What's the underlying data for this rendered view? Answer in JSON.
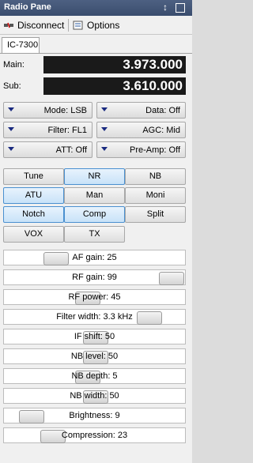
{
  "window": {
    "title": "Radio Pane",
    "pin_glyph": "↕"
  },
  "toolbar": {
    "disconnect": "Disconnect",
    "options": "Options"
  },
  "tabs": [
    {
      "label": "IC-7300"
    }
  ],
  "frequencies": {
    "main": {
      "label": "Main:",
      "value": "3.973.000"
    },
    "sub": {
      "label": "Sub:",
      "value": "3.610.000"
    }
  },
  "dropdowns": [
    {
      "label": "Mode: LSB"
    },
    {
      "label": "Data: Off"
    },
    {
      "label": "Filter: FL1"
    },
    {
      "label": "AGC: Mid"
    },
    {
      "label": "ATT: Off"
    },
    {
      "label": "Pre-Amp: Off"
    }
  ],
  "toggles": [
    {
      "label": "Tune",
      "active": false
    },
    {
      "label": "NR",
      "active": true
    },
    {
      "label": "NB",
      "active": false
    },
    {
      "label": "ATU",
      "active": true
    },
    {
      "label": "Man",
      "active": false
    },
    {
      "label": "Moni",
      "active": false
    },
    {
      "label": "Notch",
      "active": true
    },
    {
      "label": "Comp",
      "active": true
    },
    {
      "label": "Split",
      "active": false
    },
    {
      "label": "VOX",
      "active": false
    },
    {
      "label": "TX",
      "active": false
    }
  ],
  "sliders": [
    {
      "label": "AF gain: 25",
      "level": 0.25
    },
    {
      "label": "RF gain: 99",
      "level": 0.99
    },
    {
      "label": "RF power: 45",
      "level": 0.45
    },
    {
      "label": "Filter width: 3.3 kHz",
      "level": 0.85
    },
    {
      "label": "IF shift: 50",
      "level": 0.5
    },
    {
      "label": "NB level: 50",
      "level": 0.5
    },
    {
      "label": "NB depth: 5",
      "level": 0.45
    },
    {
      "label": "NB width: 50",
      "level": 0.5
    },
    {
      "label": "Brightness: 9",
      "level": 0.09
    },
    {
      "label": "Compression: 23",
      "level": 0.23
    }
  ],
  "colors": {
    "active_border": "#4a90d0",
    "freq_bg": "#1a1a1a",
    "title_bg": "#4d6082"
  }
}
